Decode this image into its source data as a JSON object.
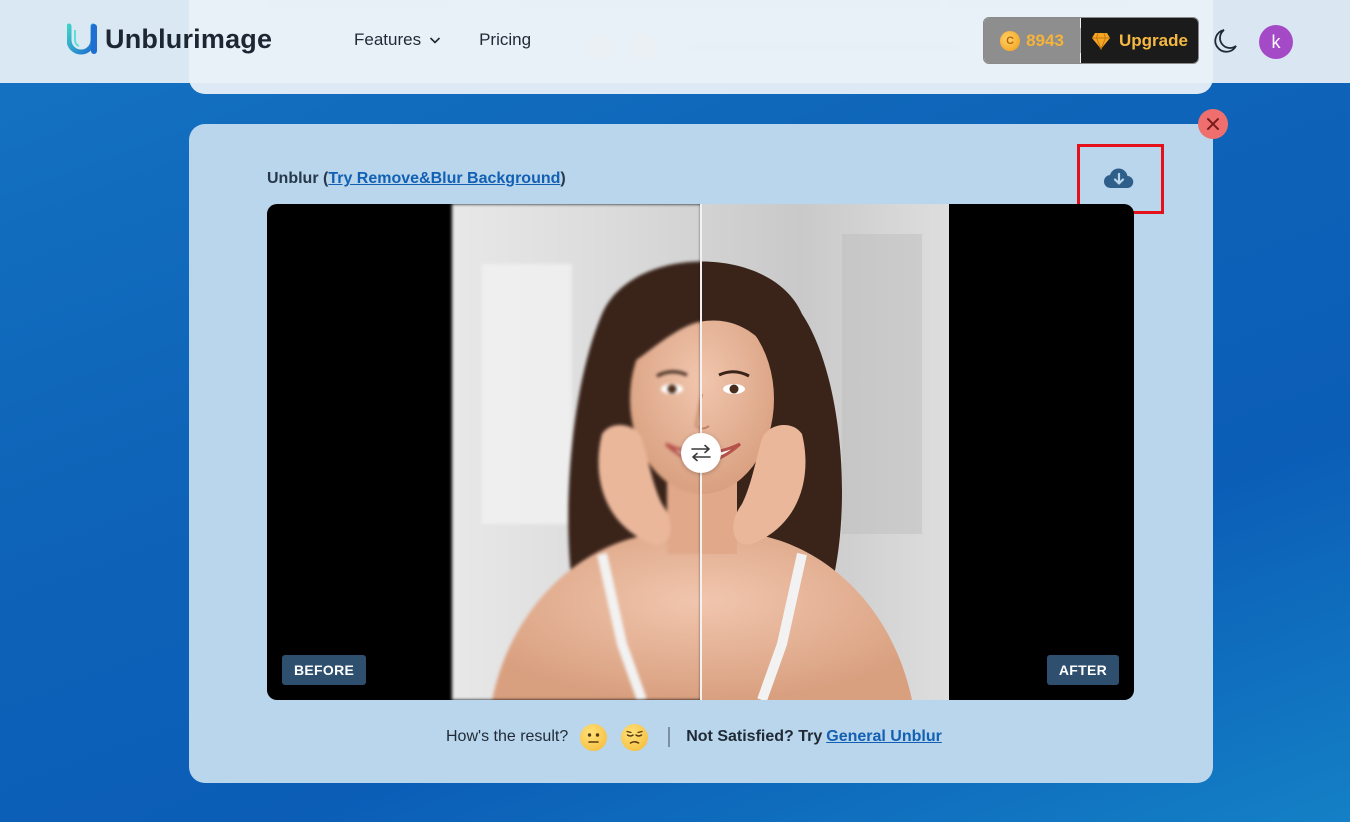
{
  "header": {
    "brand": "Unblurimage",
    "nav": [
      {
        "label": "Features",
        "has_dropdown": true
      },
      {
        "label": "Pricing",
        "has_dropdown": false
      }
    ],
    "credits": "8943",
    "upgrade_label": "Upgrade",
    "avatar_initial": "k"
  },
  "card": {
    "title_prefix": "Unblur (",
    "title_link": "Try Remove&Blur Background",
    "title_suffix": ")",
    "before_label": "BEFORE",
    "after_label": "AFTER",
    "feedback_question": "How's the result?",
    "not_satisfied": "Not Satisfied? Try",
    "alt_link": "General Unblur"
  },
  "colors": {
    "accent_link": "#1260b3",
    "upgrade_text": "#f5b942",
    "close": "#ef6f6f",
    "highlight": "#e4111b",
    "avatar": "#a54ac7"
  },
  "icons": [
    "logo-mark-icon",
    "chevron-down-icon",
    "coin-icon",
    "diamond-icon",
    "moon-icon",
    "close-icon",
    "cloud-download-icon",
    "swap-arrows-icon",
    "neutral-face-icon",
    "pensive-face-icon"
  ]
}
